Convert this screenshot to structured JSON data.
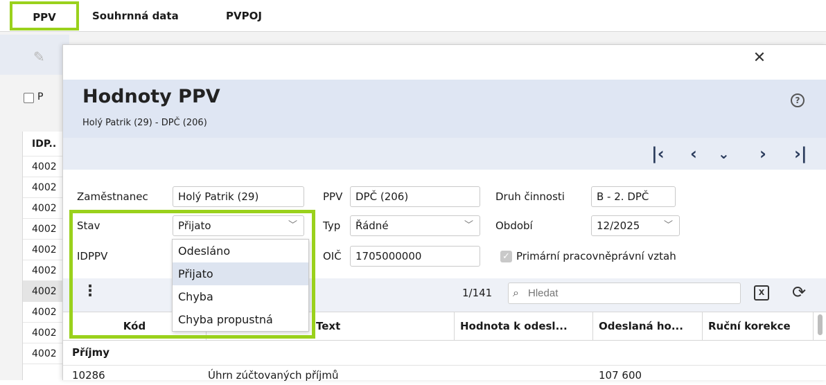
{
  "topnav": {
    "tabs": [
      "PPV",
      "Souhrnná data",
      "PVPOJ"
    ],
    "active": "PPV"
  },
  "accent_color": "#9ad11c",
  "background": {
    "checkbox_label": "P",
    "column_header": "IDP..",
    "rows": [
      "4002",
      "4002",
      "4002",
      "4002",
      "4002",
      "4002",
      "4002",
      "4002",
      "4002",
      "4002"
    ]
  },
  "dialog": {
    "title": "Hodnoty PPV",
    "subtitle": "Holý Patrik (29) - DPČ (206)",
    "close_icon": "close-icon",
    "help_icon": "help-icon",
    "nav": [
      "first-record-icon",
      "previous-record-icon",
      "expand-icon",
      "next-record-icon",
      "last-record-icon"
    ]
  },
  "form": {
    "zamestnanec_label": "Zaměstnanec",
    "zamestnanec_value": "Holý Patrik (29)",
    "ppv_label": "PPV",
    "ppv_value": "DPČ (206)",
    "druh_label": "Druh činnosti",
    "druh_value": "B - 2. DPČ",
    "stav_label": "Stav",
    "stav_value": "Přijato",
    "typ_label": "Typ",
    "typ_value": "Řádné",
    "obdobi_label": "Období",
    "obdobi_value": "12/2025",
    "idppv_label": "IDPPV",
    "oic_label": "OIČ",
    "oic_value": "1705000000",
    "primarni_label": "Primární pracovněprávní vztah",
    "primarni_checked": true
  },
  "stav_dropdown": {
    "options": [
      "Odesláno",
      "Přijato",
      "Chyba",
      "Chyba propustná"
    ],
    "selected": "Přijato"
  },
  "grid": {
    "counter": "1/141",
    "search_placeholder": "Hledat",
    "columns": [
      "Kód",
      "Text",
      "Hodnota k odesl...",
      "Odeslaná ho...",
      "Ruční korekce"
    ],
    "group": "Příjmy",
    "rows": [
      {
        "kod": "10286",
        "text": "Úhrn zúčtovaných příjmů",
        "hodnota": "",
        "odeslana": "107 600",
        "korekce": ""
      }
    ]
  }
}
